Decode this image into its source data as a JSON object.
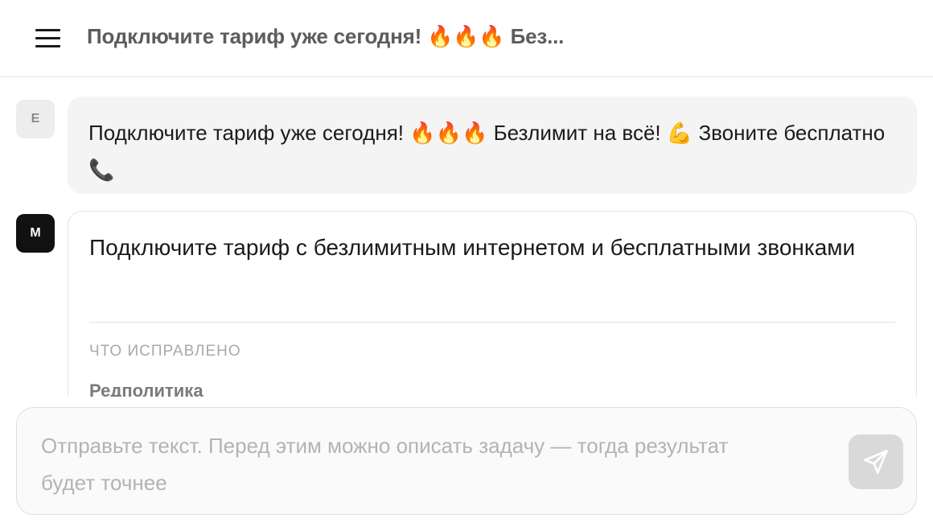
{
  "header": {
    "title": "Подключите тариф уже сегодня! 🔥🔥🔥 Без..."
  },
  "messages": [
    {
      "role": "user",
      "avatar": "E",
      "text": "Подключите тариф уже сегодня! 🔥🔥🔥 Безлимит на всё! 💪 Звоните бесплатно 📞"
    },
    {
      "role": "model",
      "avatar": "M",
      "text": "Подключите тариф с безлимитным интернетом и бесплатными звонками",
      "fixes_title": "ЧТО ИСПРАВЛЕНО",
      "fixes_items": [
        "Редполитика"
      ]
    }
  ],
  "composer": {
    "placeholder": "Отправьте текст. Перед этим можно описать задачу — тогда результат будет точнее",
    "value": "",
    "send_icon": "send-icon"
  },
  "colors": {
    "user_bubble": "#f4f4f4",
    "model_avatar": "#111111",
    "send_button_disabled": "#d9d9d9"
  }
}
